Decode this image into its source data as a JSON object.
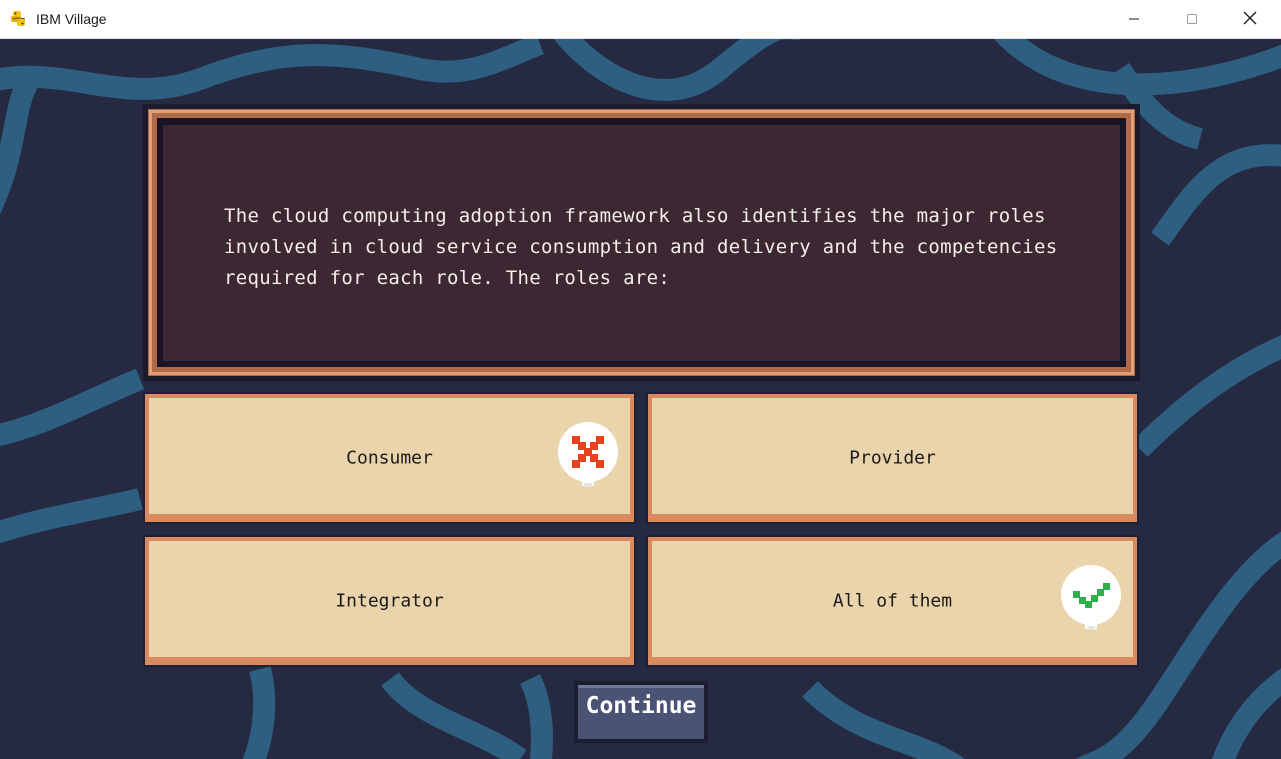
{
  "window": {
    "title": "IBM Village",
    "app_icon": "python-icon",
    "controls": [
      "minimize-icon",
      "maximize-icon",
      "close-icon"
    ]
  },
  "quiz": {
    "question": "The cloud computing adoption framework also identifies the major roles involved in cloud service consumption and delivery and the competencies required for each role. The roles are:",
    "answers": [
      {
        "label": "Consumer",
        "status": "incorrect",
        "badge_icon": "x-mark-icon"
      },
      {
        "label": "Provider",
        "status": "none"
      },
      {
        "label": "Integrator",
        "status": "none"
      },
      {
        "label": "All of them",
        "status": "correct",
        "badge_icon": "check-mark-icon"
      }
    ],
    "continue_label": "Continue"
  },
  "colors": {
    "background": "#252a42",
    "wave": "#2e5f80",
    "panel": "#3d2733",
    "panel_frame": "#b06a4a",
    "card": "#e9d4ab",
    "card_border": "#d98a5e",
    "wrong": "#e8411f",
    "right": "#2bb04a",
    "button": "#4a5373"
  }
}
